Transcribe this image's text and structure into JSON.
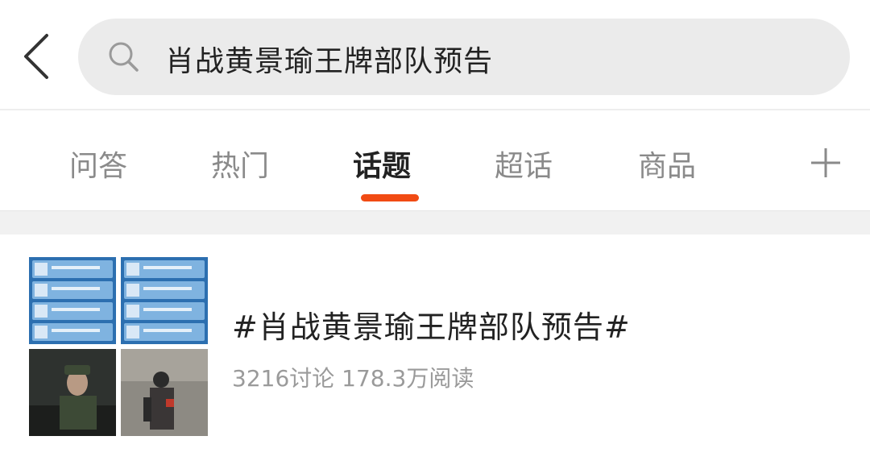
{
  "search": {
    "query": "肖战黄景瑜王牌部队预告"
  },
  "tabs": [
    {
      "label": "问答"
    },
    {
      "label": "热门"
    },
    {
      "label": "话题"
    },
    {
      "label": "超话"
    },
    {
      "label": "商品"
    }
  ],
  "active_tab": "话题",
  "colors": {
    "accent": "#f14b14",
    "search_bg": "#ebebeb"
  },
  "icons": {
    "back": "chevron-left-icon",
    "search": "search-icon",
    "more": "plus-icon"
  },
  "result": {
    "title": "#肖战黄景瑜王牌部队预告#",
    "meta": "3216讨论 178.3万阅读"
  }
}
